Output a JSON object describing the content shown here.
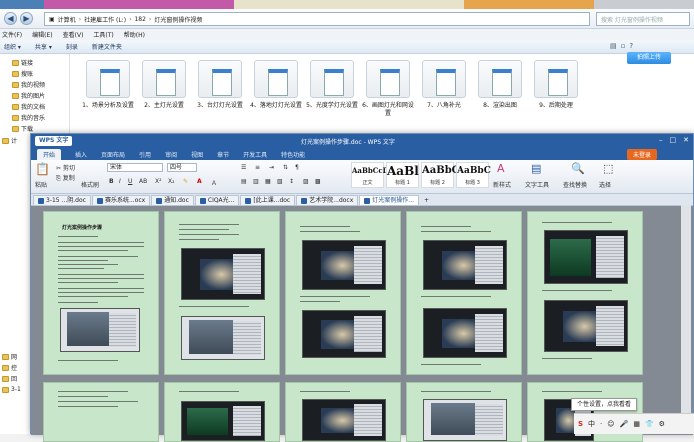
{
  "explorer": {
    "breadcrumb": [
      "计算机",
      "社建雇工作 (L:)",
      "182",
      "灯光窗例操作视频"
    ],
    "search_placeholder": "搜索 灯光窗例操作视频",
    "menu": [
      "文件(F)",
      "编辑(E)",
      "查看(V)",
      "工具(T)",
      "帮助(H)"
    ],
    "toolbar": [
      "组织 ▾",
      "共享 ▾",
      "刻录",
      "新建文件夹"
    ],
    "upload_button": "拍照上传",
    "nav_items": [
      "链接",
      "搜账",
      "我的视频",
      "我的图片",
      "我的文档",
      "我的音乐",
      "下载",
      "计",
      "网",
      "控",
      "回",
      "3-1"
    ],
    "files": [
      {
        "name": "1、场景分析及设置"
      },
      {
        "name": "2、主灯光设置"
      },
      {
        "name": "3、台灯灯光设置"
      },
      {
        "name": "4、落地灯灯光设置"
      },
      {
        "name": "5、光度学灯光设置"
      },
      {
        "name": "6、画图灯光和网设置"
      },
      {
        "name": "7、八角补光"
      },
      {
        "name": "8、渲染出图"
      },
      {
        "name": "9、后期处理"
      }
    ]
  },
  "wps": {
    "app_name": "WPS 文字",
    "title": "灯光案例操作步骤.doc - WPS 文字",
    "ribbon_tabs": [
      "开始",
      "插入",
      "页面布局",
      "引用",
      "审阅",
      "视图",
      "章节",
      "开发工具",
      "特色功能"
    ],
    "login_label": "未登录",
    "ribbon": {
      "paste": "粘贴",
      "cut": "剪切",
      "copy": "复制",
      "format_painter": "格式刷",
      "font_name": "宋体",
      "font_size": "四号",
      "styles": [
        {
          "preview": "AaBbCcDd",
          "name": "正文"
        },
        {
          "preview": "AaBl",
          "name": "标题 1"
        },
        {
          "preview": "AaBbC",
          "name": "标题 2"
        },
        {
          "preview": "AaBbC",
          "name": "标题 3"
        }
      ],
      "new_style": "新样式",
      "text_tools": "文字工具",
      "find_replace": "查找替换",
      "select": "选择"
    },
    "doc_tabs": [
      "3-15 ...阴.doc",
      "赛乐系统...ocx",
      "通知.doc",
      "CIQA光...",
      "[此上课...doc",
      "艺术学院...docx",
      "灯光案例操作..."
    ],
    "page_heading": "灯光案例操作步骤",
    "tooltip": "个性设置，点我看看",
    "tray": [
      "S",
      "中",
      "·",
      "☺",
      "🎤",
      "▦",
      "👕",
      "⚙"
    ]
  },
  "colors": {
    "wps_blue": "#2a5ea3",
    "page_green": "#c8e6c9",
    "login_orange": "#e8671e",
    "canvas_gray": "#838a93"
  }
}
